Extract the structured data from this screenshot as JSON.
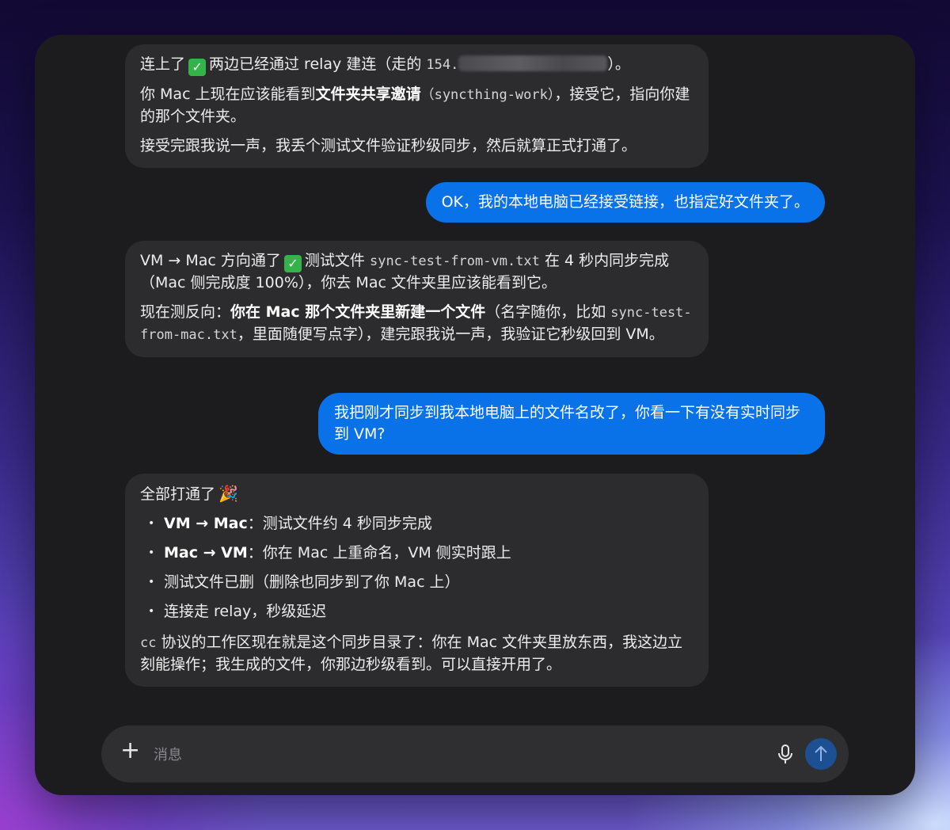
{
  "messages": [
    {
      "role": "assistant",
      "p1_a": "连上了",
      "p1_b": "两边已经通过 relay 建连（走的 ",
      "p1_ip": "154.",
      "p1_c": "）。",
      "p2_a": "你 Mac 上现在应该能看到",
      "p2_bold": "文件夹共享邀请",
      "p2_code": "（syncthing-work）",
      "p2_b": "，接受它，指向你建的那个文件夹。",
      "p3": "接受完跟我说一声，我丢个测试文件验证秒级同步，然后就算正式打通了。"
    },
    {
      "role": "user",
      "text": "OK，我的本地电脑已经接受链接，也指定好文件夹了。"
    },
    {
      "role": "assistant",
      "p1_a": "VM → Mac 方向通了",
      "p1_b": "测试文件 ",
      "p1_code": "sync-test-from-vm.txt",
      "p1_c": " 在 4 秒内同步完成（Mac 侧完成度 100%），你去 Mac 文件夹里应该能看到它。",
      "p2_a": "现在测反向：",
      "p2_bold": "你在 Mac 那个文件夹里新建一个文件",
      "p2_b": "（名字随你，比如 ",
      "p2_code": "sync-test-from-mac.txt",
      "p2_c": "，里面随便写点字），建完跟我说一声，我验证它秒级回到 VM。"
    },
    {
      "role": "user",
      "text": "我把刚才同步到我本地电脑上的文件名改了，你看一下有没有实时同步到 VM?"
    },
    {
      "role": "assistant",
      "intro": "全部打通了",
      "items": [
        {
          "bold": "VM → Mac",
          "text": "：测试文件约 4 秒同步完成"
        },
        {
          "bold": "Mac → VM",
          "text": "：你在 Mac 上重命名，VM 侧实时跟上"
        },
        {
          "bold": "",
          "text": "测试文件已删（删除也同步到了你 Mac 上）"
        },
        {
          "bold": "",
          "text": "连接走 relay，秒级延迟"
        }
      ],
      "outro_code": "cc",
      "outro": " 协议的工作区现在就是这个同步目录了：你在 Mac 文件夹里放东西，我这边立刻能操作；我生成的文件，你那边秒级看到。可以直接开用了。"
    }
  ],
  "composer": {
    "placeholder": "消息"
  },
  "icons": {
    "plus": "plus-icon",
    "mic": "microphone-icon",
    "send": "arrow-up-icon",
    "check": "check-mark-icon",
    "party": "party-popper-icon"
  }
}
